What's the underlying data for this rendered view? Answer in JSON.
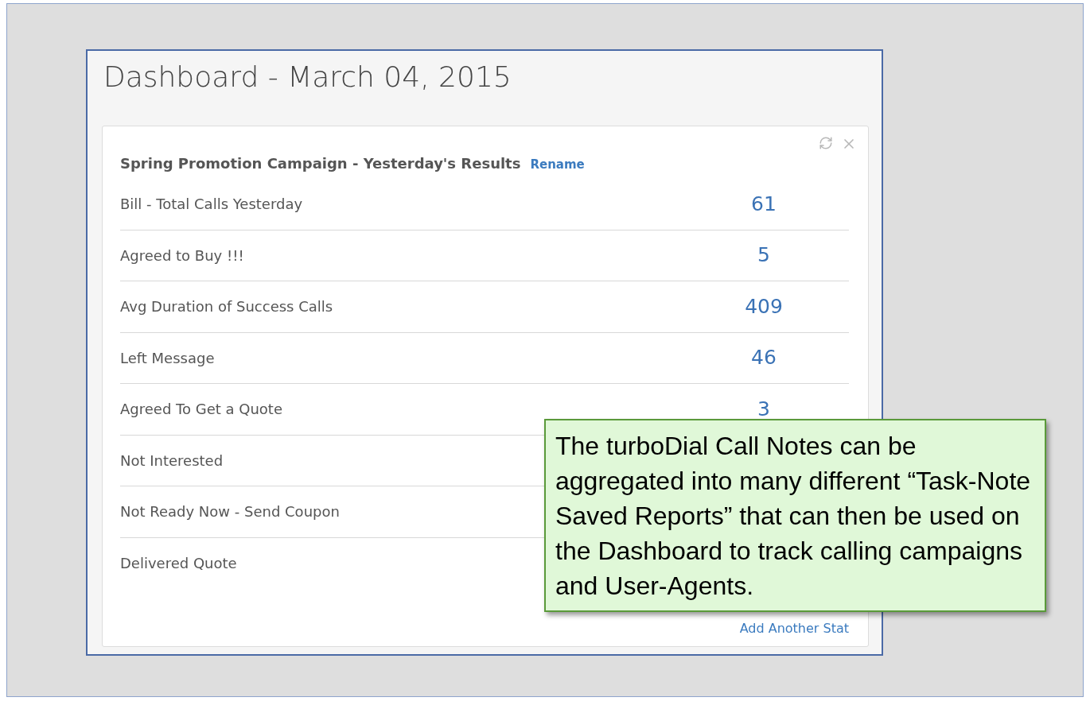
{
  "page": {
    "title": "Dashboard - March 04, 2015"
  },
  "widget": {
    "title": "Spring Promotion Campaign - Yesterday's Results",
    "rename_link": "Rename",
    "stats": [
      {
        "label": "Bill - Total Calls Yesterday",
        "value": "61"
      },
      {
        "label": "Agreed to Buy !!!",
        "value": "5"
      },
      {
        "label": "Avg Duration of Success Calls",
        "value": "409"
      },
      {
        "label": "Left Message",
        "value": "46"
      },
      {
        "label": "Agreed To Get a Quote",
        "value": "3"
      },
      {
        "label": "Not Interested"
      },
      {
        "label": "Not Ready Now - Send Coupon"
      },
      {
        "label": "Delivered Quote"
      }
    ],
    "add_link": "Add Another Stat"
  },
  "callout": {
    "text": "The turboDial Call Notes can be aggregated into many different “Task-Note Saved Reports” that can then be used on the Dashboard to track calling campaigns and User-Agents."
  }
}
